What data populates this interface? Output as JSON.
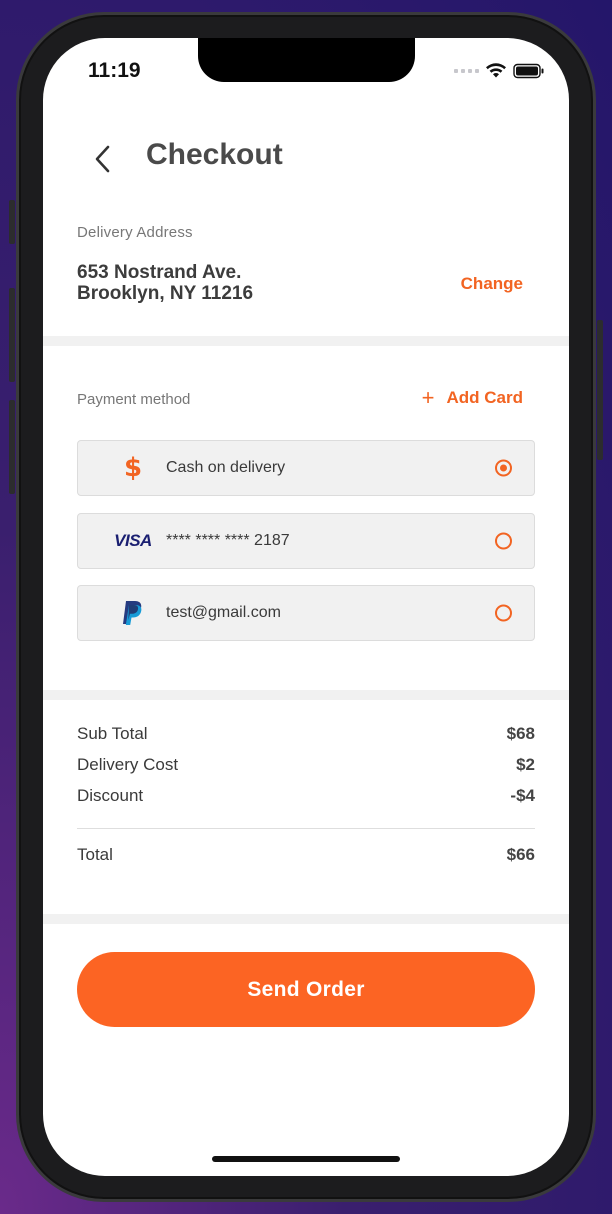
{
  "status_bar": {
    "time": "11:19"
  },
  "header": {
    "title": "Checkout"
  },
  "delivery": {
    "label": "Delivery Address",
    "line1": "653 Nostrand Ave.",
    "line2": "Brooklyn, NY 11216",
    "change_label": "Change"
  },
  "payment": {
    "label": "Payment method",
    "add_card_plus": "+",
    "add_card_label": "Add Card",
    "options": [
      {
        "icon": "dollar-icon",
        "icon_text": "$",
        "text": "Cash on delivery",
        "selected": true
      },
      {
        "icon": "visa-icon",
        "icon_text": "VISA",
        "text": "**** **** **** 2187",
        "selected": false
      },
      {
        "icon": "paypal-icon",
        "text": "test@gmail.com",
        "selected": false
      }
    ]
  },
  "summary": {
    "rows": [
      {
        "label": "Sub Total",
        "value": "$68"
      },
      {
        "label": "Delivery Cost",
        "value": "$2"
      },
      {
        "label": "Discount",
        "value": "-$4"
      }
    ],
    "total": {
      "label": "Total",
      "value": "$66"
    }
  },
  "send_order_label": "Send Order",
  "colors": {
    "accent": "#fc6423",
    "text": "#3a3a3a",
    "background": "#ffffff",
    "option_bg": "#f1f1f1"
  }
}
